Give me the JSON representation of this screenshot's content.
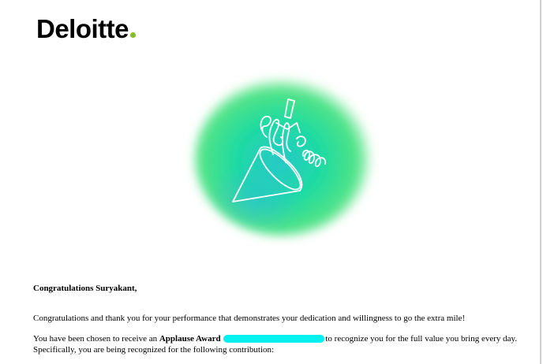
{
  "brand": {
    "logo_text": "Deloitte",
    "dot_color": "#86bc25"
  },
  "hero": {
    "icon": "party-popper-icon",
    "gradient_colors": [
      "#1de39a",
      "#2ad0c8",
      "#3ee06a"
    ]
  },
  "message": {
    "greeting": "Congratulations Suryakant,",
    "thanks": "Congratulations and thank you for your performance that demonstrates your dedication and willingness to go the extra mile!",
    "chosen_prefix": "You have been chosen to receive an ",
    "award_name": "Applause Award",
    "chosen_suffix": "to recognize you for the full value you bring every day.",
    "specifically": "Specifically, you are being recognized for the following contribution:"
  },
  "redaction_color": "#00f0f0"
}
